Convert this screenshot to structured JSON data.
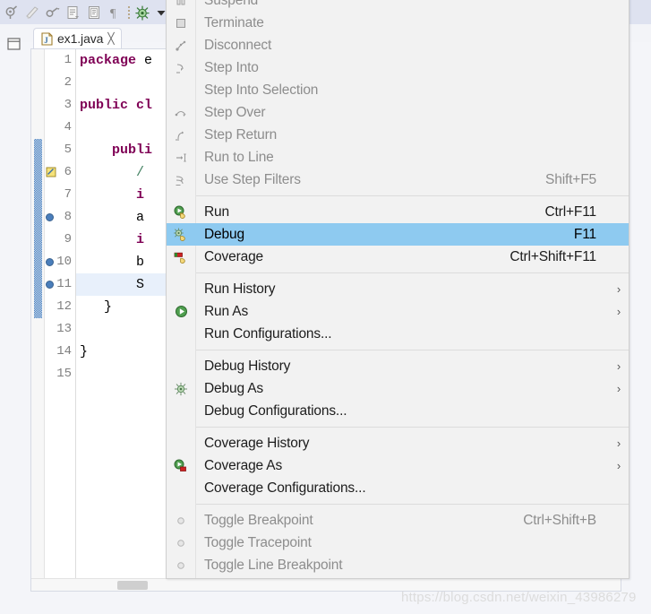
{
  "toolbar": {
    "icons": [
      {
        "name": "debug-icon",
        "title": "Debug"
      },
      {
        "name": "run-icon",
        "title": "Run"
      },
      {
        "name": "external-tools-icon",
        "title": "External Tools"
      },
      {
        "name": "new-java-file-icon",
        "title": "New Java File"
      },
      {
        "name": "open-type-icon",
        "title": "Open Type"
      },
      {
        "name": "pilcrow-icon",
        "title": "Show Whitespace"
      }
    ],
    "separator": "toolbar-separator",
    "last_icon": {
      "name": "debug-bug-icon",
      "title": "Debug"
    },
    "dropdown_arrow": "chevron-down-icon"
  },
  "view_stack": {
    "icon": "restore-view-icon"
  },
  "editor": {
    "tab": {
      "file_icon": "java-file-icon",
      "label": "ex1.java",
      "close": "╳"
    },
    "lines": [
      {
        "num": "1",
        "marker": "",
        "fold": "",
        "current": false,
        "tokens": [
          {
            "t": "package",
            "c": "kw"
          },
          {
            "t": " e",
            "c": "plain"
          }
        ]
      },
      {
        "num": "2",
        "marker": "",
        "fold": "",
        "current": false,
        "tokens": []
      },
      {
        "num": "3",
        "marker": "",
        "fold": "",
        "current": false,
        "tokens": [
          {
            "t": "public cl",
            "c": "kw"
          }
        ]
      },
      {
        "num": "4",
        "marker": "",
        "fold": "",
        "current": false,
        "tokens": []
      },
      {
        "num": "5",
        "marker": "",
        "fold": "⊖",
        "current": false,
        "tokens": [
          {
            "t": "    publi",
            "c": "kw"
          }
        ]
      },
      {
        "num": "6",
        "marker": "quickfix",
        "fold": "",
        "current": false,
        "tokens": [
          {
            "t": "       /",
            "c": "cmt"
          }
        ]
      },
      {
        "num": "7",
        "marker": "",
        "fold": "",
        "current": false,
        "tokens": [
          {
            "t": "       i",
            "c": "kw"
          }
        ]
      },
      {
        "num": "8",
        "marker": "breakpoint",
        "fold": "",
        "current": false,
        "tokens": [
          {
            "t": "       a",
            "c": "plain"
          }
        ]
      },
      {
        "num": "9",
        "marker": "",
        "fold": "",
        "current": false,
        "tokens": [
          {
            "t": "       i",
            "c": "kw"
          }
        ]
      },
      {
        "num": "10",
        "marker": "breakpoint",
        "fold": "",
        "current": false,
        "tokens": [
          {
            "t": "       b",
            "c": "plain"
          }
        ]
      },
      {
        "num": "11",
        "marker": "breakpoint",
        "fold": "",
        "current": true,
        "tokens": [
          {
            "t": "       S",
            "c": "plain"
          }
        ]
      },
      {
        "num": "12",
        "marker": "",
        "fold": "",
        "current": false,
        "tokens": [
          {
            "t": "   }",
            "c": "plain"
          }
        ]
      },
      {
        "num": "13",
        "marker": "",
        "fold": "",
        "current": false,
        "tokens": []
      },
      {
        "num": "14",
        "marker": "",
        "fold": "",
        "current": false,
        "tokens": [
          {
            "t": "}",
            "c": "plain"
          }
        ]
      },
      {
        "num": "15",
        "marker": "",
        "fold": "",
        "current": false,
        "tokens": []
      }
    ],
    "hscrollbar": "horizontal-scrollbar"
  },
  "context_menu": {
    "groups": [
      {
        "items": [
          {
            "label": "Suspend",
            "accel": "",
            "icon": "suspend-icon",
            "disabled": true,
            "submenu": false,
            "selected": false
          },
          {
            "label": "Terminate",
            "accel": "",
            "icon": "terminate-icon",
            "disabled": true,
            "submenu": false,
            "selected": false
          },
          {
            "label": "Disconnect",
            "accel": "",
            "icon": "disconnect-icon",
            "disabled": true,
            "submenu": false,
            "selected": false
          },
          {
            "label": "Step Into",
            "accel": "",
            "icon": "step-into-icon",
            "disabled": true,
            "submenu": false,
            "selected": false
          },
          {
            "label": "Step Into Selection",
            "accel": "",
            "icon": "",
            "disabled": true,
            "submenu": false,
            "selected": false
          },
          {
            "label": "Step Over",
            "accel": "",
            "icon": "step-over-icon",
            "disabled": true,
            "submenu": false,
            "selected": false
          },
          {
            "label": "Step Return",
            "accel": "",
            "icon": "step-return-icon",
            "disabled": true,
            "submenu": false,
            "selected": false
          },
          {
            "label": "Run to Line",
            "accel": "",
            "icon": "run-to-line-icon",
            "disabled": true,
            "submenu": false,
            "selected": false
          },
          {
            "label": "Use Step Filters",
            "accel": "Shift+F5",
            "icon": "step-filters-icon",
            "disabled": true,
            "submenu": false,
            "selected": false
          }
        ]
      },
      {
        "items": [
          {
            "label": "Run",
            "accel": "Ctrl+F11",
            "icon": "run-icon",
            "disabled": false,
            "submenu": false,
            "selected": false
          },
          {
            "label": "Debug",
            "accel": "F11",
            "icon": "debug-icon",
            "disabled": false,
            "submenu": false,
            "selected": true
          },
          {
            "label": "Coverage",
            "accel": "Ctrl+Shift+F11",
            "icon": "coverage-icon",
            "disabled": false,
            "submenu": false,
            "selected": false
          }
        ]
      },
      {
        "items": [
          {
            "label": "Run History",
            "accel": "",
            "icon": "",
            "disabled": false,
            "submenu": true,
            "selected": false
          },
          {
            "label": "Run As",
            "accel": "",
            "icon": "run-as-icon",
            "disabled": false,
            "submenu": true,
            "selected": false
          },
          {
            "label": "Run Configurations...",
            "accel": "",
            "icon": "",
            "disabled": false,
            "submenu": false,
            "selected": false
          }
        ]
      },
      {
        "items": [
          {
            "label": "Debug History",
            "accel": "",
            "icon": "",
            "disabled": false,
            "submenu": true,
            "selected": false
          },
          {
            "label": "Debug As",
            "accel": "",
            "icon": "debug-as-icon",
            "disabled": false,
            "submenu": true,
            "selected": false
          },
          {
            "label": "Debug Configurations...",
            "accel": "",
            "icon": "",
            "disabled": false,
            "submenu": false,
            "selected": false
          }
        ]
      },
      {
        "items": [
          {
            "label": "Coverage History",
            "accel": "",
            "icon": "",
            "disabled": false,
            "submenu": true,
            "selected": false
          },
          {
            "label": "Coverage As",
            "accel": "",
            "icon": "coverage-as-icon",
            "disabled": false,
            "submenu": true,
            "selected": false
          },
          {
            "label": "Coverage Configurations...",
            "accel": "",
            "icon": "",
            "disabled": false,
            "submenu": false,
            "selected": false
          }
        ]
      },
      {
        "items": [
          {
            "label": "Toggle Breakpoint",
            "accel": "Ctrl+Shift+B",
            "icon": "breakpoint-icon",
            "disabled": true,
            "submenu": false,
            "selected": false
          },
          {
            "label": "Toggle Tracepoint",
            "accel": "",
            "icon": "breakpoint-icon",
            "disabled": true,
            "submenu": false,
            "selected": false
          },
          {
            "label": "Toggle Line Breakpoint",
            "accel": "",
            "icon": "breakpoint-icon",
            "disabled": true,
            "submenu": false,
            "selected": false
          }
        ]
      }
    ]
  },
  "watermark": {
    "text": "https://blog.csdn.net/weixin_43986279"
  },
  "colors": {
    "menu_background": "#f2f2f2",
    "menu_selected": "#8ecaf0",
    "keyword": "#7f0055",
    "comment": "#3f7f5f",
    "current_line": "#e8f0fb",
    "ide_band": "#dee2f0"
  }
}
